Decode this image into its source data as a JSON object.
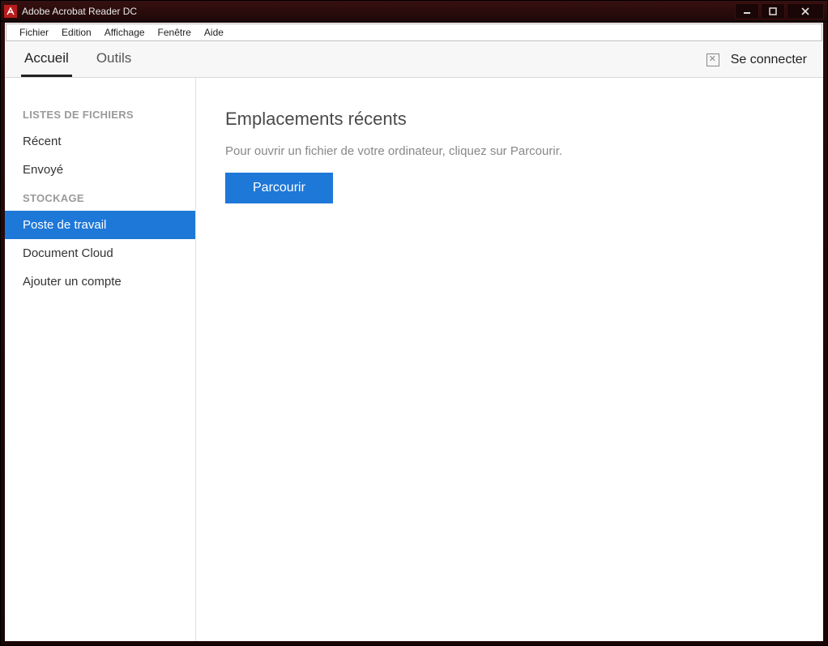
{
  "window": {
    "title": "Adobe Acrobat Reader DC"
  },
  "menubar": {
    "items": [
      "Fichier",
      "Edition",
      "Affichage",
      "Fenêtre",
      "Aide"
    ]
  },
  "toolbar": {
    "tabs": [
      {
        "label": "Accueil",
        "active": true
      },
      {
        "label": "Outils",
        "active": false
      }
    ],
    "signin_label": "Se connecter"
  },
  "sidebar": {
    "sections": [
      {
        "heading": "LISTES DE FICHIERS",
        "items": [
          {
            "label": "Récent",
            "selected": false
          },
          {
            "label": "Envoyé",
            "selected": false
          }
        ]
      },
      {
        "heading": "STOCKAGE",
        "items": [
          {
            "label": "Poste de travail",
            "selected": true
          },
          {
            "label": "Document Cloud",
            "selected": false
          },
          {
            "label": "Ajouter un compte",
            "selected": false
          }
        ]
      }
    ]
  },
  "main": {
    "title": "Emplacements récents",
    "subtitle": "Pour ouvrir un fichier de votre ordinateur, cliquez sur Parcourir.",
    "browse_label": "Parcourir"
  }
}
